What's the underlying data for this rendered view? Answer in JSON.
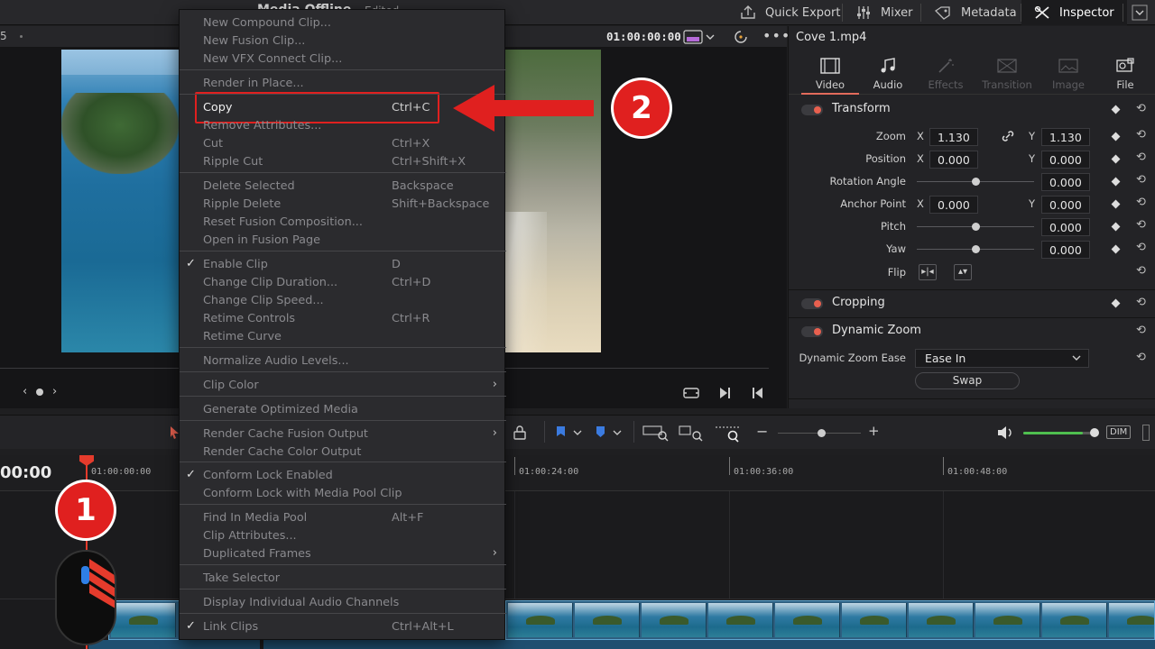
{
  "topbar": {
    "page_title": "Media Offline",
    "page_sub": "Edited",
    "quick_export": "Quick Export",
    "mixer": "Mixer",
    "metadata": "Metadata",
    "inspector": "Inspector"
  },
  "viewer": {
    "left_num": "5",
    "timecode": "01:00:00:00"
  },
  "inspector": {
    "title": "Cove 1.mp4",
    "tabs": [
      {
        "label": "Video"
      },
      {
        "label": "Audio"
      },
      {
        "label": "Effects"
      },
      {
        "label": "Transition"
      },
      {
        "label": "Image"
      },
      {
        "label": "File"
      }
    ],
    "transform": {
      "name": "Transform",
      "zoom_label": "Zoom",
      "zoom_x": "1.130",
      "zoom_y": "1.130",
      "position_label": "Position",
      "position_x": "0.000",
      "position_y": "0.000",
      "rotation_label": "Rotation Angle",
      "rotation": "0.000",
      "anchor_label": "Anchor Point",
      "anchor_x": "0.000",
      "anchor_y": "0.000",
      "pitch_label": "Pitch",
      "pitch": "0.000",
      "yaw_label": "Yaw",
      "yaw": "0.000",
      "flip_label": "Flip",
      "x": "X",
      "y": "Y"
    },
    "cropping": "Cropping",
    "dynamic_zoom": {
      "name": "Dynamic Zoom",
      "ease_label": "Dynamic Zoom Ease",
      "ease_value": "Ease In",
      "swap": "Swap"
    }
  },
  "timeline": {
    "timecode": "00:00",
    "ruler": [
      "01:00:00:00",
      "01:00:24:00",
      "01:00:36:00",
      "01:00:48:00"
    ],
    "dim": "DIM",
    "volume_level": 0.82
  },
  "context_menu": {
    "items": [
      {
        "label": "New Compound Clip...",
        "dim": true
      },
      {
        "label": "New Fusion Clip...",
        "dim": true
      },
      {
        "label": "New VFX Connect Clip...",
        "dim": true
      },
      {
        "label": "Render in Place...",
        "dim": true
      },
      {
        "label": "Copy",
        "shortcut": "Ctrl+C"
      },
      {
        "label": "Remove Attributes...",
        "dim": true
      },
      {
        "label": "Cut",
        "shortcut": "Ctrl+X",
        "dim": true
      },
      {
        "label": "Ripple Cut",
        "shortcut": "Ctrl+Shift+X",
        "dim": true
      },
      {
        "label": "Delete Selected",
        "shortcut": "Backspace",
        "dim": true
      },
      {
        "label": "Ripple Delete",
        "shortcut": "Shift+Backspace",
        "dim": true
      },
      {
        "label": "Reset Fusion Composition...",
        "dim": true
      },
      {
        "label": "Open in Fusion Page",
        "dim": true
      },
      {
        "label": "Enable Clip",
        "shortcut": "D",
        "checked": true,
        "dim": true
      },
      {
        "label": "Change Clip Duration...",
        "shortcut": "Ctrl+D",
        "dim": true
      },
      {
        "label": "Change Clip Speed...",
        "dim": true
      },
      {
        "label": "Retime Controls",
        "shortcut": "Ctrl+R",
        "dim": true
      },
      {
        "label": "Retime Curve",
        "dim": true
      },
      {
        "label": "Normalize Audio Levels...",
        "dim": true
      },
      {
        "label": "Clip Color",
        "submenu": true,
        "dim": true
      },
      {
        "label": "Generate Optimized Media",
        "dim": true
      },
      {
        "label": "Render Cache Fusion Output",
        "submenu": true,
        "dim": true
      },
      {
        "label": "Render Cache Color Output",
        "dim": true
      },
      {
        "label": "Conform Lock Enabled",
        "checked": true,
        "dim": true
      },
      {
        "label": "Conform Lock with Media Pool Clip",
        "dim": true
      },
      {
        "label": "Find In Media Pool",
        "shortcut": "Alt+F",
        "dim": true
      },
      {
        "label": "Clip Attributes...",
        "dim": true
      },
      {
        "label": "Duplicated Frames",
        "submenu": true,
        "dim": true
      },
      {
        "label": "Take Selector",
        "dim": true
      },
      {
        "label": "Display Individual Audio Channels",
        "dim": true
      },
      {
        "label": "Link Clips",
        "shortcut": "Ctrl+Alt+L",
        "checked": true,
        "dim": true
      }
    ]
  },
  "annotations": {
    "step1": "1",
    "step2": "2",
    "accent": "#e0201f"
  }
}
